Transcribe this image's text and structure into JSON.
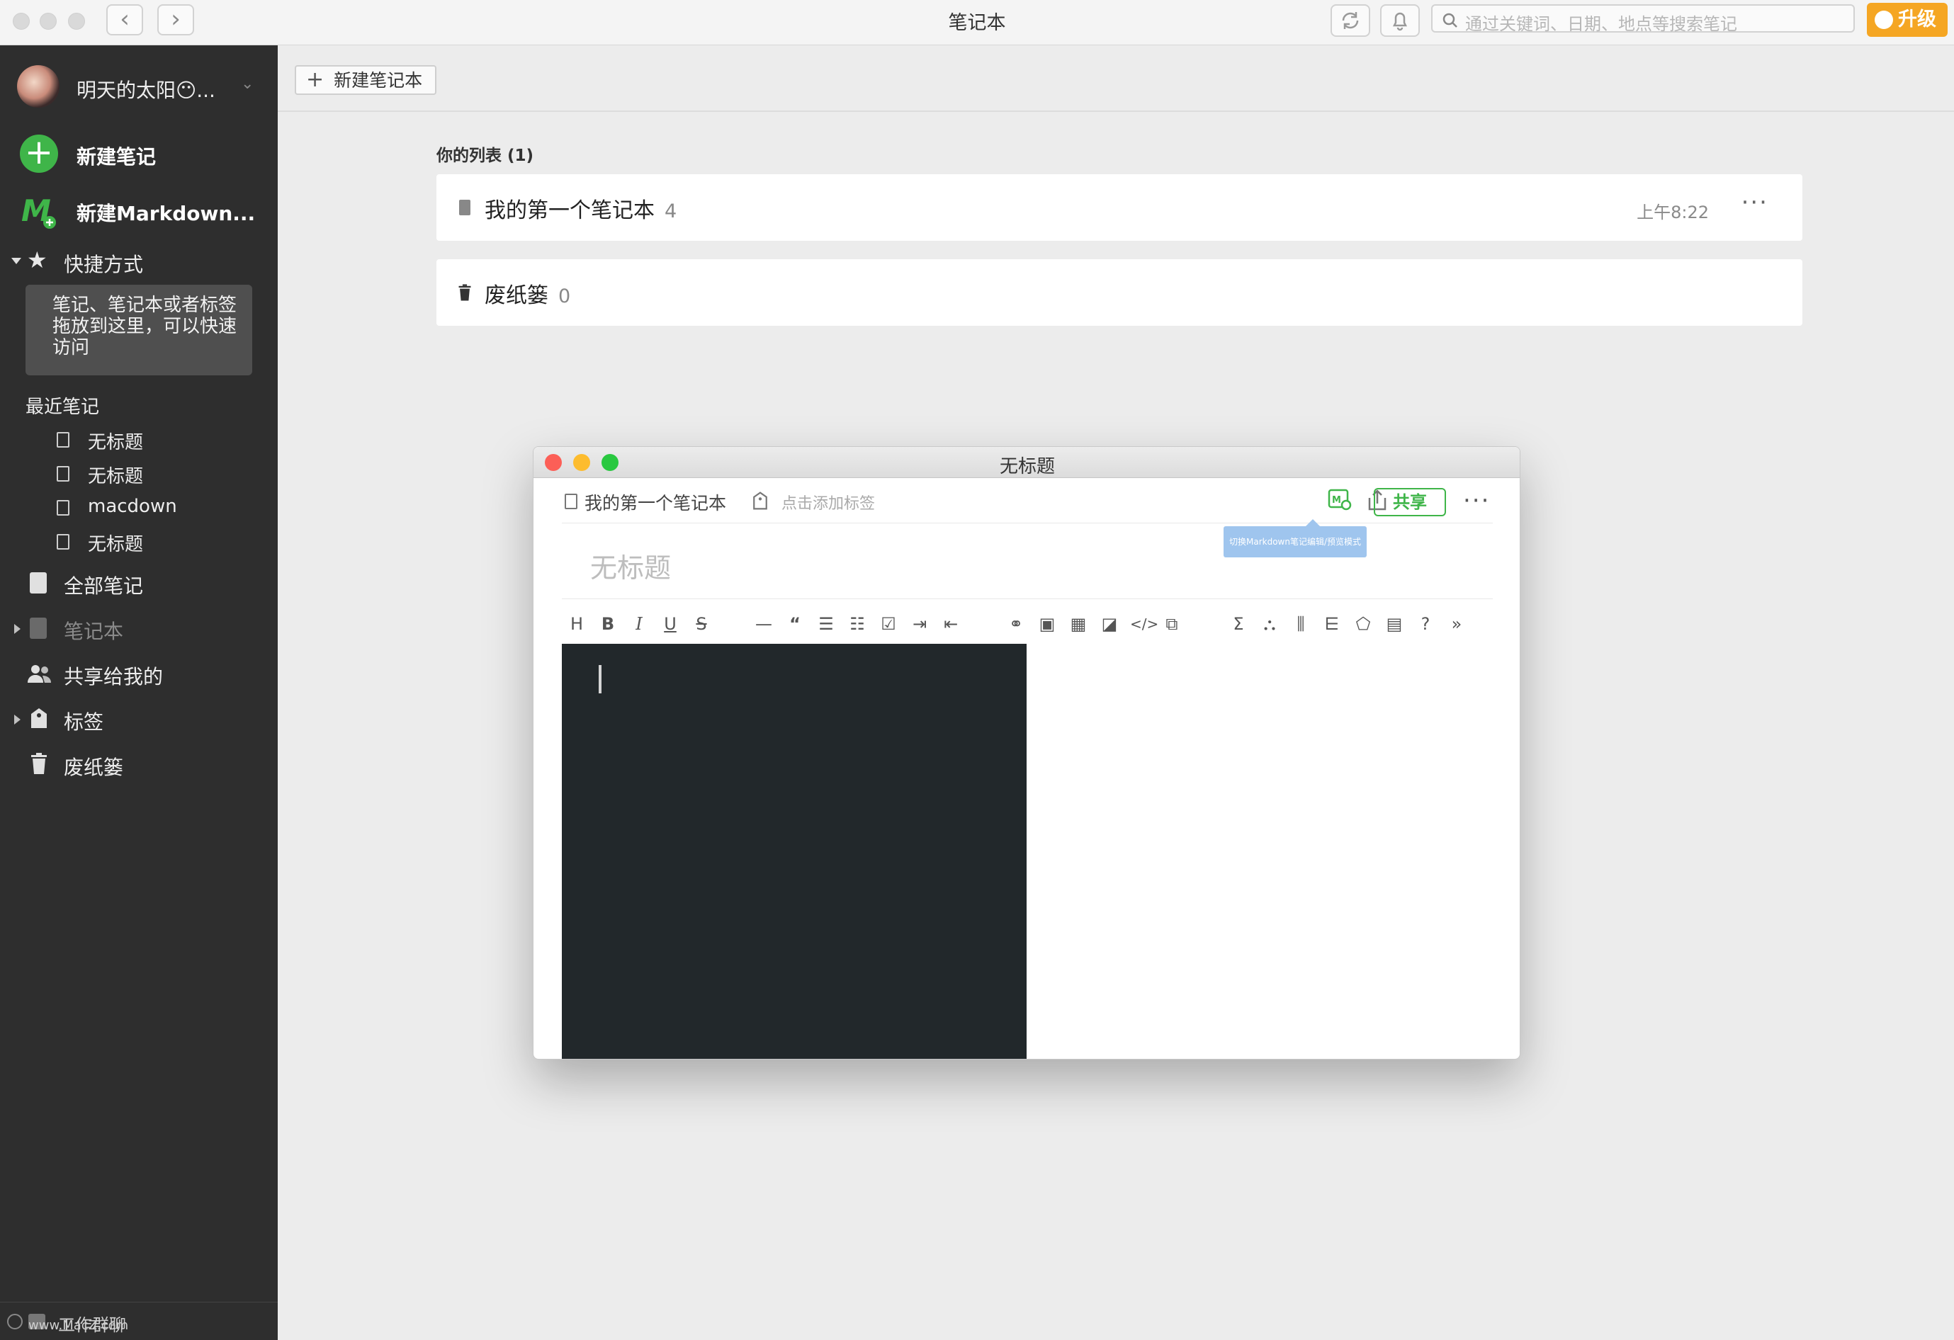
{
  "window": {
    "title": "笔记本"
  },
  "search": {
    "placeholder": "通过关键词、日期、地点等搜索笔记"
  },
  "upgrade_label": "升级",
  "sidebar": {
    "user_name": "明天的太阳😶...",
    "new_note": "新建笔记",
    "new_markdown": "新建Markdown...",
    "shortcuts": "快捷方式",
    "shortcut_hint": "笔记、笔记本或者标签拖放到这里，可以快速访问",
    "recent_label": "最近笔记",
    "recent_notes": [
      "无标题",
      "无标题",
      "macdown",
      "无标题"
    ],
    "all_notes": "全部笔记",
    "notebooks": "笔记本",
    "shared": "共享给我的",
    "tags": "标签",
    "trash": "废纸篓",
    "footer": "工作群聊",
    "footer_watermark": "www.MacZ.com"
  },
  "main": {
    "new_notebook": "新建笔记本",
    "list_title": "你的列表 (1)",
    "notebooks": [
      {
        "name": "我的第一个笔记本",
        "count": "4",
        "time": "上午8:22"
      },
      {
        "name": "废纸篓",
        "count": "0",
        "time": ""
      }
    ]
  },
  "editor": {
    "title": "无标题",
    "notebook": "我的第一个笔记本",
    "tag_placeholder": "点击添加标签",
    "share_label": "共享",
    "tooltip": "切换Markdown笔记编辑/预览模式",
    "heading_placeholder": "无标题"
  },
  "colors": {
    "accent": "#3fb549",
    "upgrade": "#f5a623",
    "sidebar": "#2e2e2e",
    "editor_dark": "#22282b"
  }
}
